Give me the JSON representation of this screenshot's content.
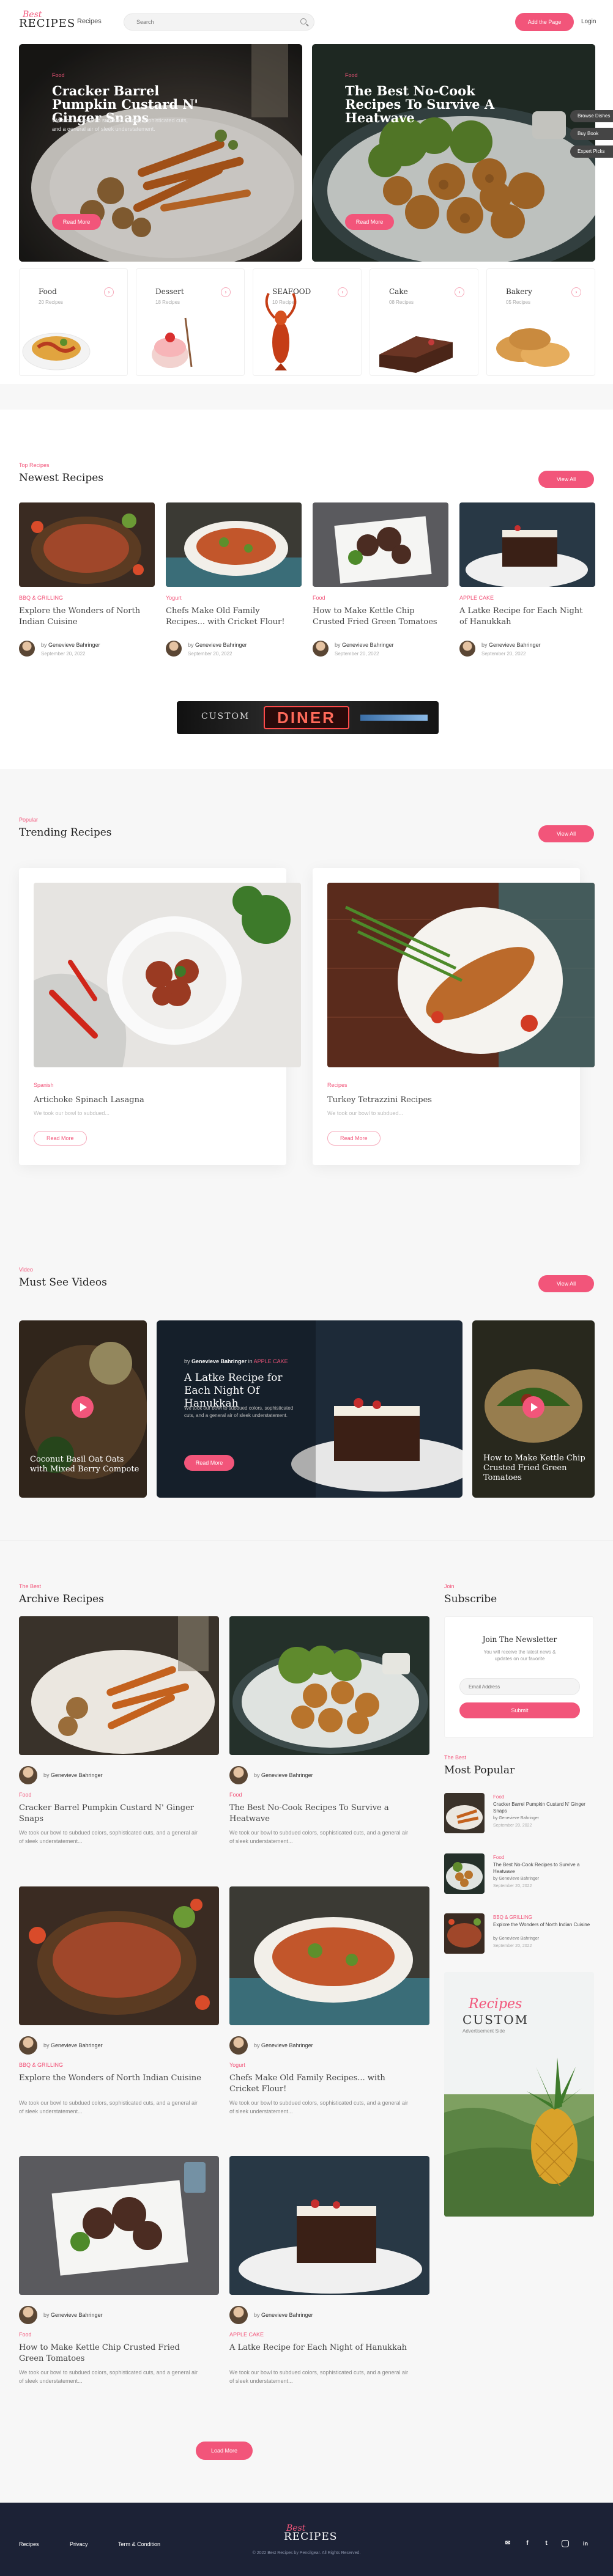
{
  "header": {
    "logo_small": "Best",
    "logo_big": "RECIPES",
    "nav_recipes": "Recipes",
    "search_placeholder": "Search",
    "add_button": "Add the Page",
    "login": "Login"
  },
  "hero": [
    {
      "category": "Food",
      "title": "Cracker Barrel Pumpkin Custard N' Ginger Snaps",
      "description": "We took our bowl to subdued colors, sophisticated cuts, and a general air of sleek understatement.",
      "button": "Read More"
    },
    {
      "category": "Food",
      "title": "The Best No-Cook Recipes To Survive A Heatwave",
      "description": "",
      "button": "Read More"
    }
  ],
  "side_tags": [
    "Browse Dishes",
    "Buy Book",
    "Expert Picks"
  ],
  "categories": [
    {
      "name": "Food",
      "count": "20 Recipes"
    },
    {
      "name": "Dessert",
      "count": "18 Recipes"
    },
    {
      "name": "SEAFOOD",
      "count": "10 Recipes"
    },
    {
      "name": "Cake",
      "count": "08 Recipes"
    },
    {
      "name": "Bakery",
      "count": "05 Recipes"
    }
  ],
  "newest": {
    "kicker": "Top Recipes",
    "heading": "Newest Recipes",
    "view_all": "View All",
    "items": [
      {
        "category": "BBQ & GRILLING",
        "title": "Explore the Wonders of North Indian Cuisine",
        "author": "Genevieve Bahringer",
        "date": "September 20, 2022"
      },
      {
        "category": "Yogurt",
        "title": "Chefs Make Old Family Recipes... with Cricket Flour!",
        "author": "Genevieve Bahringer",
        "date": "September 20, 2022"
      },
      {
        "category": "Food",
        "title": "How to Make Kettle Chip Crusted Fried Green Tomatoes",
        "author": "Genevieve Bahringer",
        "date": "September 20, 2022"
      },
      {
        "category": "APPLE CAKE",
        "title": "A Latke Recipe for Each Night of Hanukkah",
        "author": "Genevieve Bahringer",
        "date": "September 20, 2022"
      }
    ]
  },
  "ad_banner": {
    "left": "CUSTOM",
    "center": "DINER"
  },
  "trending": {
    "kicker": "Popular",
    "heading": "Trending Recipes",
    "view_all": "View All",
    "items": [
      {
        "category": "Spanish",
        "title": "Artichoke Spinach Lasagna",
        "description": "We took our bowl to subdued...",
        "button": "Read More"
      },
      {
        "category": "Recipes",
        "title": "Turkey Tetrazzini Recipes",
        "description": "We took our bowl to subdued...",
        "button": "Read More"
      }
    ]
  },
  "videos": {
    "kicker": "Video",
    "heading": "Must See Videos",
    "view_all": "View All",
    "items": [
      {
        "title": "Coconut Basil Oat Oats with Mixed Berry Compote"
      },
      {
        "author": "Genevieve Bahringer",
        "category": "APPLE CAKE",
        "title": "A Latke Recipe for Each Night Of Hanukkah",
        "description": "We took our bowl to subdued colors, sophisticated cuts, and a general air of sleek understatement.",
        "button": "Read More"
      },
      {
        "title": "How to Make Kettle Chip Crusted Fried Green Tomatoes"
      }
    ]
  },
  "archive": {
    "kicker": "The Best",
    "heading": "Archive Recipes",
    "items": [
      {
        "author": "Genevieve Bahringer",
        "category": "Food",
        "title": "Cracker Barrel Pumpkin Custard N' Ginger Snaps",
        "description": "We took our bowl to subdued colors, sophisticated cuts, and a general air of sleek understatement..."
      },
      {
        "author": "Genevieve Bahringer",
        "category": "Food",
        "title": "The Best No-Cook Recipes To Survive a Heatwave",
        "description": "We took our bowl to subdued colors, sophisticated cuts, and a general air of sleek understatement..."
      },
      {
        "author": "Genevieve Bahringer",
        "category": "BBQ & GRILLING",
        "title": "Explore the Wonders of North Indian Cuisine",
        "description": "We took our bowl to subdued colors, sophisticated cuts, and a general air of sleek understatement..."
      },
      {
        "author": "Genevieve Bahringer",
        "category": "Yogurt",
        "title": "Chefs Make Old Family Recipes... with Cricket Flour!",
        "description": "We took our bowl to subdued colors, sophisticated cuts, and a general air of sleek understatement..."
      },
      {
        "author": "Genevieve Bahringer",
        "category": "Food",
        "title": "How to Make Kettle Chip Crusted Fried Green Tomatoes",
        "description": "We took our bowl to subdued colors, sophisticated cuts, and a general air of sleek understatement..."
      },
      {
        "author": "Genevieve Bahringer",
        "category": "APPLE CAKE",
        "title": "A Latke Recipe for Each Night of Hanukkah",
        "description": "We took our bowl to subdued colors, sophisticated cuts, and a general air of sleek understatement..."
      }
    ],
    "load_more": "Load More"
  },
  "subscribe": {
    "kicker": "Join",
    "heading": "Subscribe",
    "box_title": "Join The Newsletter",
    "box_text": "You will receive the latest news & updates on our favorite",
    "email_placeholder": "Email Address",
    "button": "Submit"
  },
  "popular": {
    "kicker": "The Best",
    "heading": "Most Popular",
    "items": [
      {
        "category": "Food",
        "title": "Cracker Barrel Pumpkin Custard N' Ginger Snaps",
        "author": "Genevieve Bahringer",
        "date": "September 20, 2022"
      },
      {
        "category": "Food",
        "title": "The Best No-Cook Recipes to Survive a Heatwave",
        "author": "Genevieve Bahringer",
        "date": "September 20, 2022"
      },
      {
        "category": "BBQ & GRILLING",
        "title": "Explore the Wonders of North Indian Cuisine",
        "author": "Genevieve Bahringer",
        "date": "September 20, 2022"
      }
    ]
  },
  "side_ad": {
    "script": "Recipes",
    "big": "CUSTOM",
    "small": "Advertisement Side"
  },
  "footer": {
    "links": [
      "Recipes",
      "Privacy",
      "Term & Condition"
    ],
    "logo_small": "Best",
    "logo_big": "RECIPES",
    "copyright": "© 2022 Best Recipes by Pencilgear. All Rights Reserved.",
    "social": [
      "mail",
      "facebook",
      "twitter",
      "instagram",
      "linkedin"
    ]
  },
  "colors": {
    "accent": "#f2557a",
    "footer_bg": "#1c2236",
    "section_bg": "#f7f7f7"
  }
}
